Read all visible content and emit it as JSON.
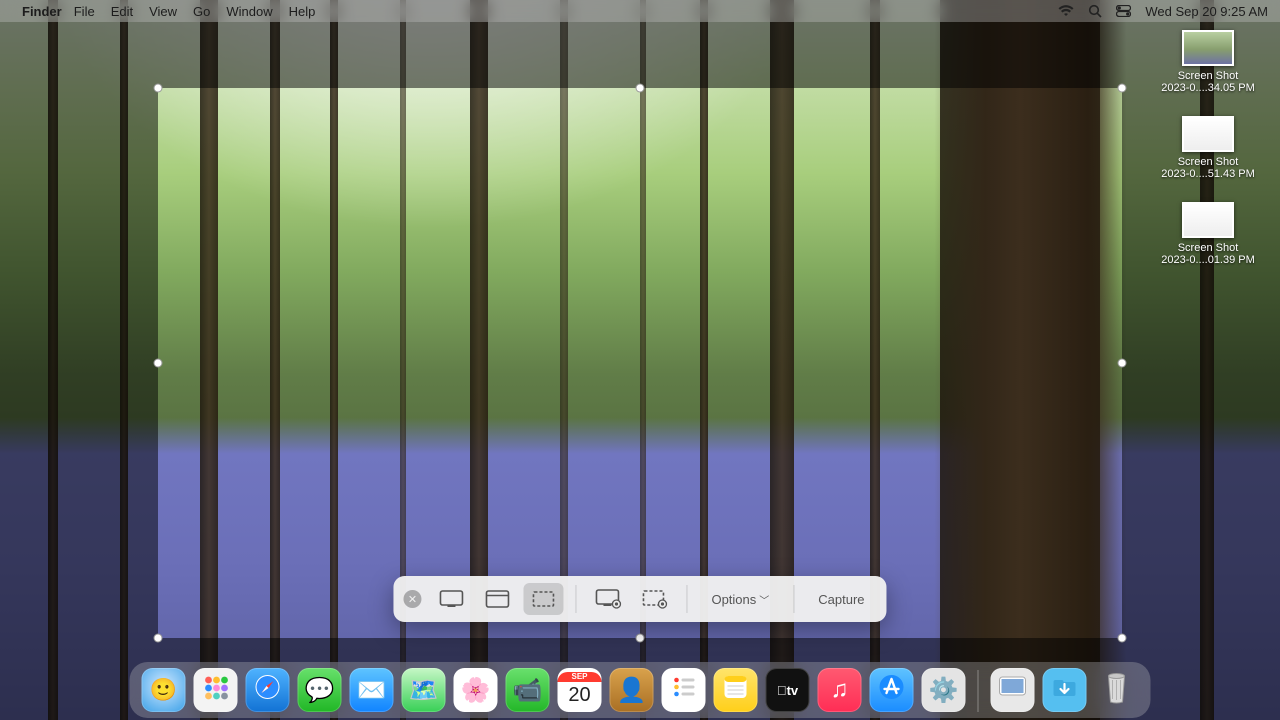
{
  "menubar": {
    "app": "Finder",
    "items": [
      "File",
      "Edit",
      "View",
      "Go",
      "Window",
      "Help"
    ],
    "clock": "Wed Sep 20  9:25 AM"
  },
  "screenshot_toolbar": {
    "options_label": "Options",
    "capture_label": "Capture"
  },
  "desktop_files": [
    {
      "line1": "Screen Shot",
      "line2": "2023-0....34.05 PM"
    },
    {
      "line1": "Screen Shot",
      "line2": "2023-0....51.43 PM"
    },
    {
      "line1": "Screen Shot",
      "line2": "2023-0....01.39 PM"
    }
  ],
  "dock": {
    "calendar_month": "SEP",
    "calendar_day": "20"
  }
}
